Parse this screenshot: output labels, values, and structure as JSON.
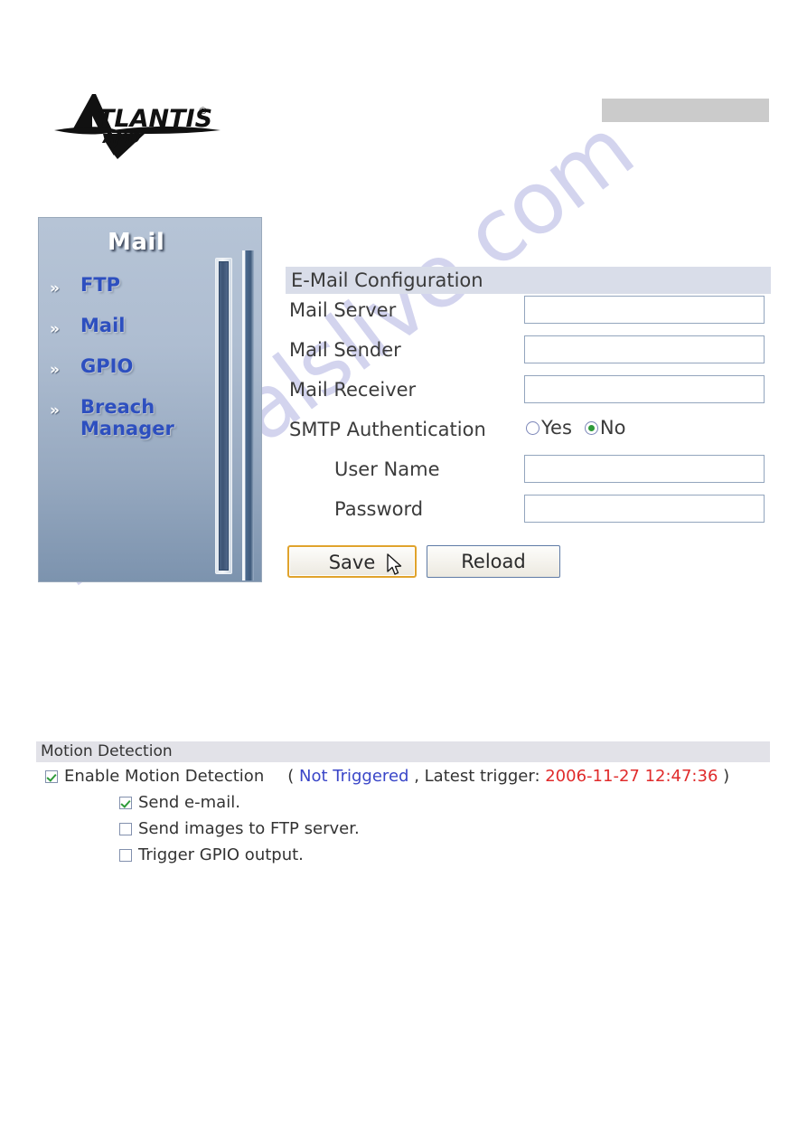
{
  "brand": {
    "logo_name": "ATLANTIS",
    "logo_sub": "LAND",
    "logo_mark": "atlantis-land-logo"
  },
  "top_bar": {
    "label": "",
    "color": "#cbcbcb"
  },
  "watermark": {
    "text": "manualslive.com",
    "color": "#b9bbe4"
  },
  "sidebar": {
    "title": "Mail",
    "chevron": "»",
    "items": [
      {
        "label": "FTP"
      },
      {
        "label": "Mail"
      },
      {
        "label": "GPIO"
      },
      {
        "label": "Breach Manager"
      }
    ],
    "scrollbar": {
      "thumb_color": "#44608400"
    }
  },
  "form": {
    "header": "E-Mail Configuration",
    "fields": [
      {
        "label": "Mail Server",
        "value": "",
        "placeholder": ""
      },
      {
        "label": "Mail Sender",
        "value": "",
        "placeholder": ""
      },
      {
        "label": "Mail Receiver",
        "value": "",
        "placeholder": ""
      }
    ],
    "smtp": {
      "label": "SMTP Authentication",
      "options": [
        {
          "label": "Yes",
          "selected": false
        },
        {
          "label": "No",
          "selected": true
        }
      ]
    },
    "credentials": [
      {
        "label": "User Name",
        "value": "",
        "placeholder": ""
      },
      {
        "label": "Password",
        "value": "",
        "placeholder": ""
      }
    ],
    "buttons": {
      "save": "Save",
      "reload": "Reload"
    }
  },
  "motion_detection": {
    "header": "Motion Detection",
    "enable_label": "Enable Motion Detection",
    "enable_checked": true,
    "status": {
      "open_paren": "(",
      "state": "Not Triggered",
      "separator": ", Latest trigger: ",
      "timestamp": "2006-11-27 12:47:36",
      "close_paren": ")",
      "state_color": "#3a46c8",
      "timestamp_color": "#e02b2b"
    },
    "actions": [
      {
        "label": "Send e-mail.",
        "checked": true
      },
      {
        "label": "Send images to FTP server.",
        "checked": false
      },
      {
        "label": "Trigger GPIO output.",
        "checked": false
      }
    ]
  }
}
